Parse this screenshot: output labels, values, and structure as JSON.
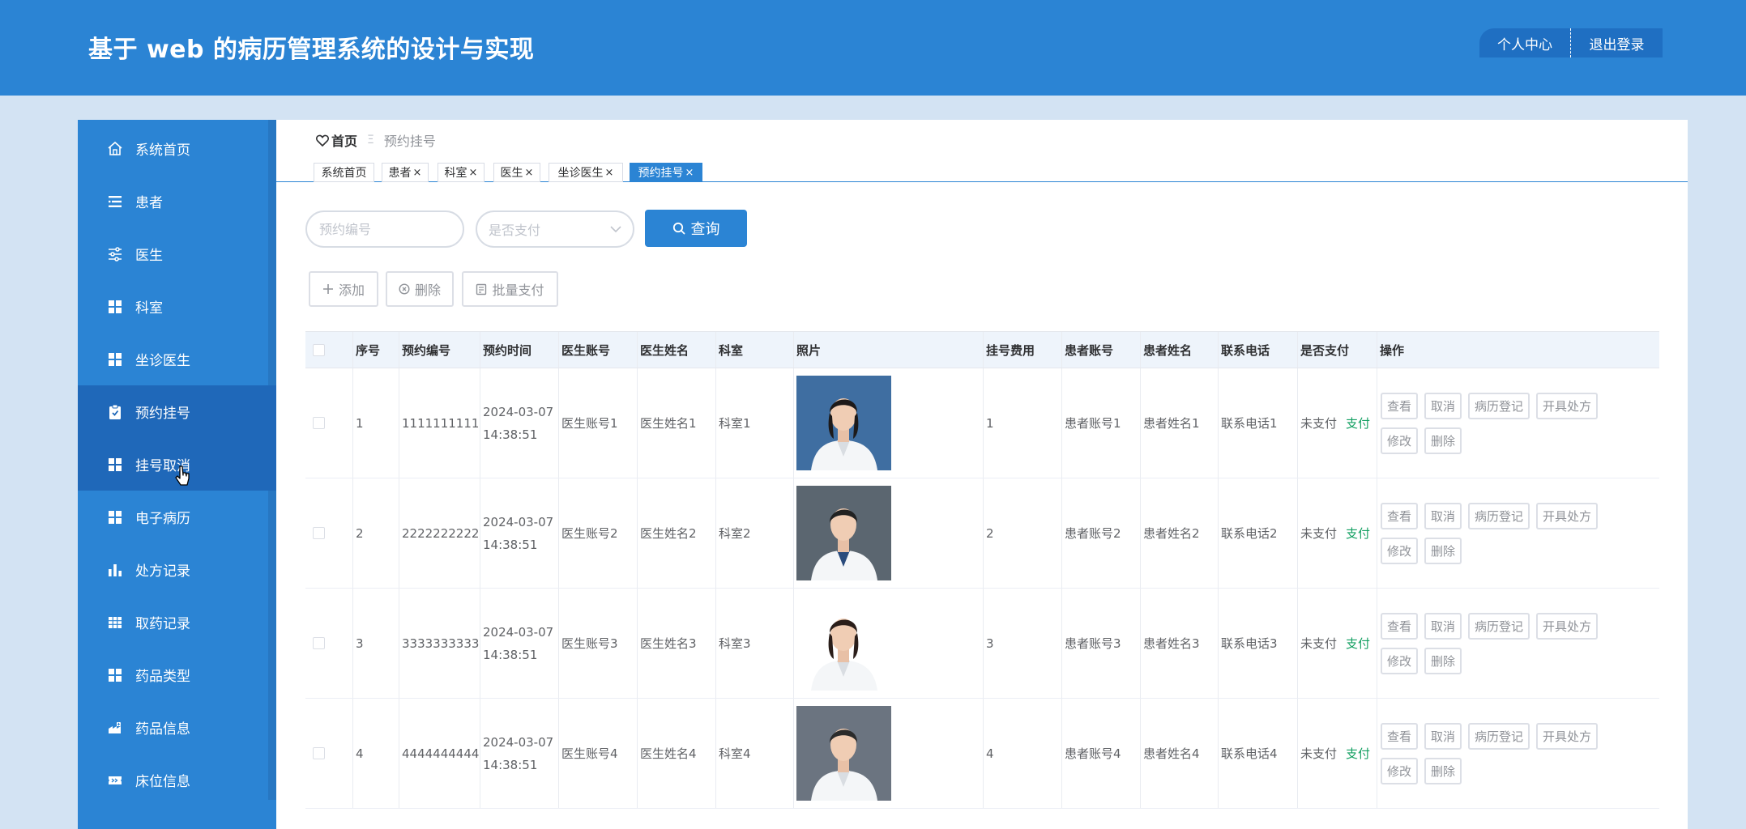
{
  "header": {
    "title": "基于 web 的病历管理系统的设计与实现",
    "profile_label": "个人中心",
    "logout_label": "退出登录"
  },
  "sidebar": {
    "items": [
      {
        "label": "系统首页",
        "icon": "home-icon"
      },
      {
        "label": "患者",
        "icon": "list-icon"
      },
      {
        "label": "医生",
        "icon": "sliders-icon"
      },
      {
        "label": "科室",
        "icon": "grid-icon"
      },
      {
        "label": "坐诊医生",
        "icon": "grid-icon"
      },
      {
        "label": "预约挂号",
        "icon": "clipboard-icon"
      },
      {
        "label": "挂号取消",
        "icon": "grid-icon"
      },
      {
        "label": "电子病历",
        "icon": "grid-icon"
      },
      {
        "label": "处方记录",
        "icon": "bar-chart-icon"
      },
      {
        "label": "取药记录",
        "icon": "table-icon"
      },
      {
        "label": "药品类型",
        "icon": "grid-icon"
      },
      {
        "label": "药品信息",
        "icon": "medicine-icon"
      },
      {
        "label": "床位信息",
        "icon": "ticket-icon"
      }
    ],
    "active_index": 5,
    "hover_index": 6
  },
  "breadcrumb": {
    "home": "首页",
    "separator": "Ξ",
    "current": "预约挂号"
  },
  "tabs": [
    {
      "label": "系统首页",
      "closable": false
    },
    {
      "label": "患者",
      "closable": true
    },
    {
      "label": "科室",
      "closable": true
    },
    {
      "label": "医生",
      "closable": true
    },
    {
      "label": "坐诊医生",
      "closable": true
    },
    {
      "label": "预约挂号",
      "closable": true,
      "active": true
    }
  ],
  "tab_close_glyph": "×",
  "search": {
    "id_placeholder": "预约编号",
    "paid_placeholder": "是否支付",
    "query_label": "查询"
  },
  "actions": {
    "add_label": "添加",
    "delete_label": "删除",
    "batch_pay_label": "批量支付"
  },
  "table": {
    "columns": [
      "序号",
      "预约编号",
      "预约时间",
      "医生账号",
      "医生姓名",
      "科室",
      "照片",
      "挂号费用",
      "患者账号",
      "患者姓名",
      "联系电话",
      "是否支付",
      "操作"
    ],
    "rows": [
      {
        "index": "1",
        "booking_no": "1111111111",
        "time": "2024-03-07 14:38:51",
        "doctor_account": "医生账号1",
        "doctor_name": "医生姓名1",
        "department": "科室1",
        "fee": "1",
        "patient_account": "患者账号1",
        "patient_name": "患者姓名1",
        "phone": "联系电话1",
        "paid": "未支付",
        "pay_link": "支付"
      },
      {
        "index": "2",
        "booking_no": "2222222222",
        "time": "2024-03-07 14:38:51",
        "doctor_account": "医生账号2",
        "doctor_name": "医生姓名2",
        "department": "科室2",
        "fee": "2",
        "patient_account": "患者账号2",
        "patient_name": "患者姓名2",
        "phone": "联系电话2",
        "paid": "未支付",
        "pay_link": "支付"
      },
      {
        "index": "3",
        "booking_no": "3333333333",
        "time": "2024-03-07 14:38:51",
        "doctor_account": "医生账号3",
        "doctor_name": "医生姓名3",
        "department": "科室3",
        "fee": "3",
        "patient_account": "患者账号3",
        "patient_name": "患者姓名3",
        "phone": "联系电话3",
        "paid": "未支付",
        "pay_link": "支付"
      },
      {
        "index": "4",
        "booking_no": "4444444444",
        "time": "2024-03-07 14:38:51",
        "doctor_account": "医生账号4",
        "doctor_name": "医生姓名4",
        "department": "科室4",
        "fee": "4",
        "patient_account": "患者账号4",
        "patient_name": "患者姓名4",
        "phone": "联系电话4",
        "paid": "未支付",
        "pay_link": "支付"
      }
    ],
    "row_actions": [
      "查看",
      "取消",
      "病历登记",
      "开具处方",
      "修改",
      "删除"
    ]
  },
  "colors": {
    "primary": "#2b84d4",
    "sidebar_active": "#1f68b9",
    "pay_link": "#13a062",
    "page_bg": "#d3e3f3"
  }
}
